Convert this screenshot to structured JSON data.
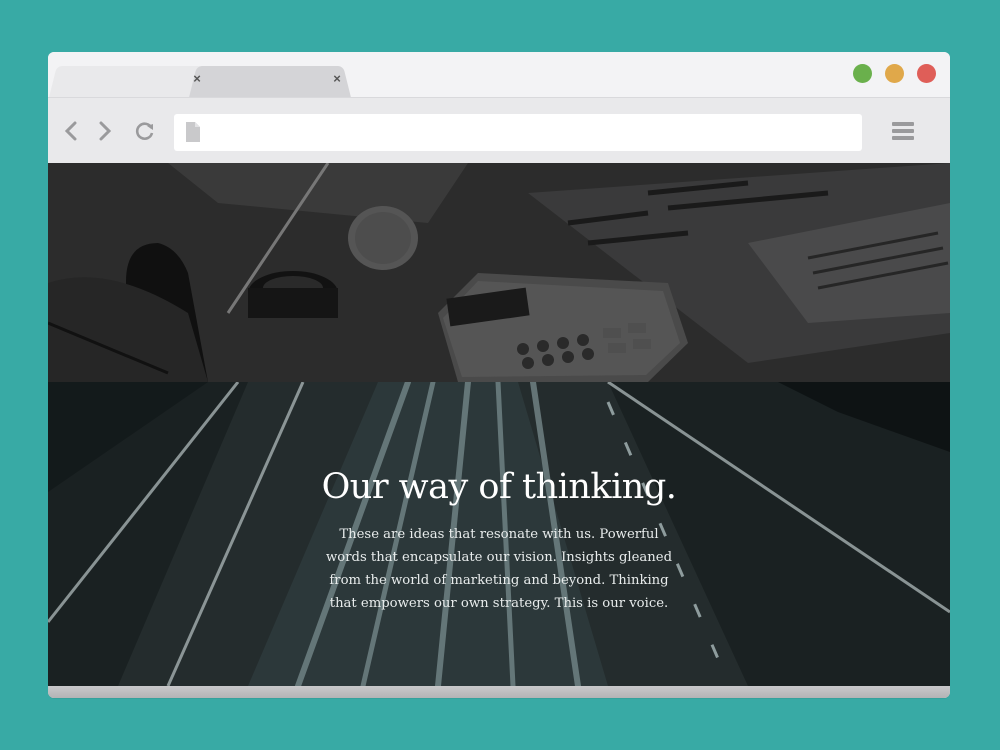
{
  "browser": {
    "tabs": [
      {
        "label": "",
        "close": "×",
        "active": true
      },
      {
        "label": "",
        "close": "×",
        "active": false
      }
    ],
    "window_controls": [
      {
        "name": "maximize",
        "color": "#6ab04c"
      },
      {
        "name": "minimize",
        "color": "#e0a84a"
      },
      {
        "name": "close",
        "color": "#df5e58"
      }
    ],
    "nav": {
      "back_icon": "chevron-left-icon",
      "forward_icon": "chevron-right-icon",
      "reload_icon": "reload-icon",
      "menu_icon": "hamburger-icon"
    },
    "address": {
      "value": "",
      "icon": "page-icon"
    }
  },
  "page": {
    "headline": "Our way of thinking.",
    "description": "These are ideas that resonate with us. Powerful words that encapsulate our vision. Insights gleaned from the world of marketing and beyond. Thinking that empowers our own strategy. This is our voice."
  },
  "colors": {
    "background": "#38aaa5",
    "chrome": "#e9e9eb",
    "tabbar": "#f3f3f5"
  }
}
